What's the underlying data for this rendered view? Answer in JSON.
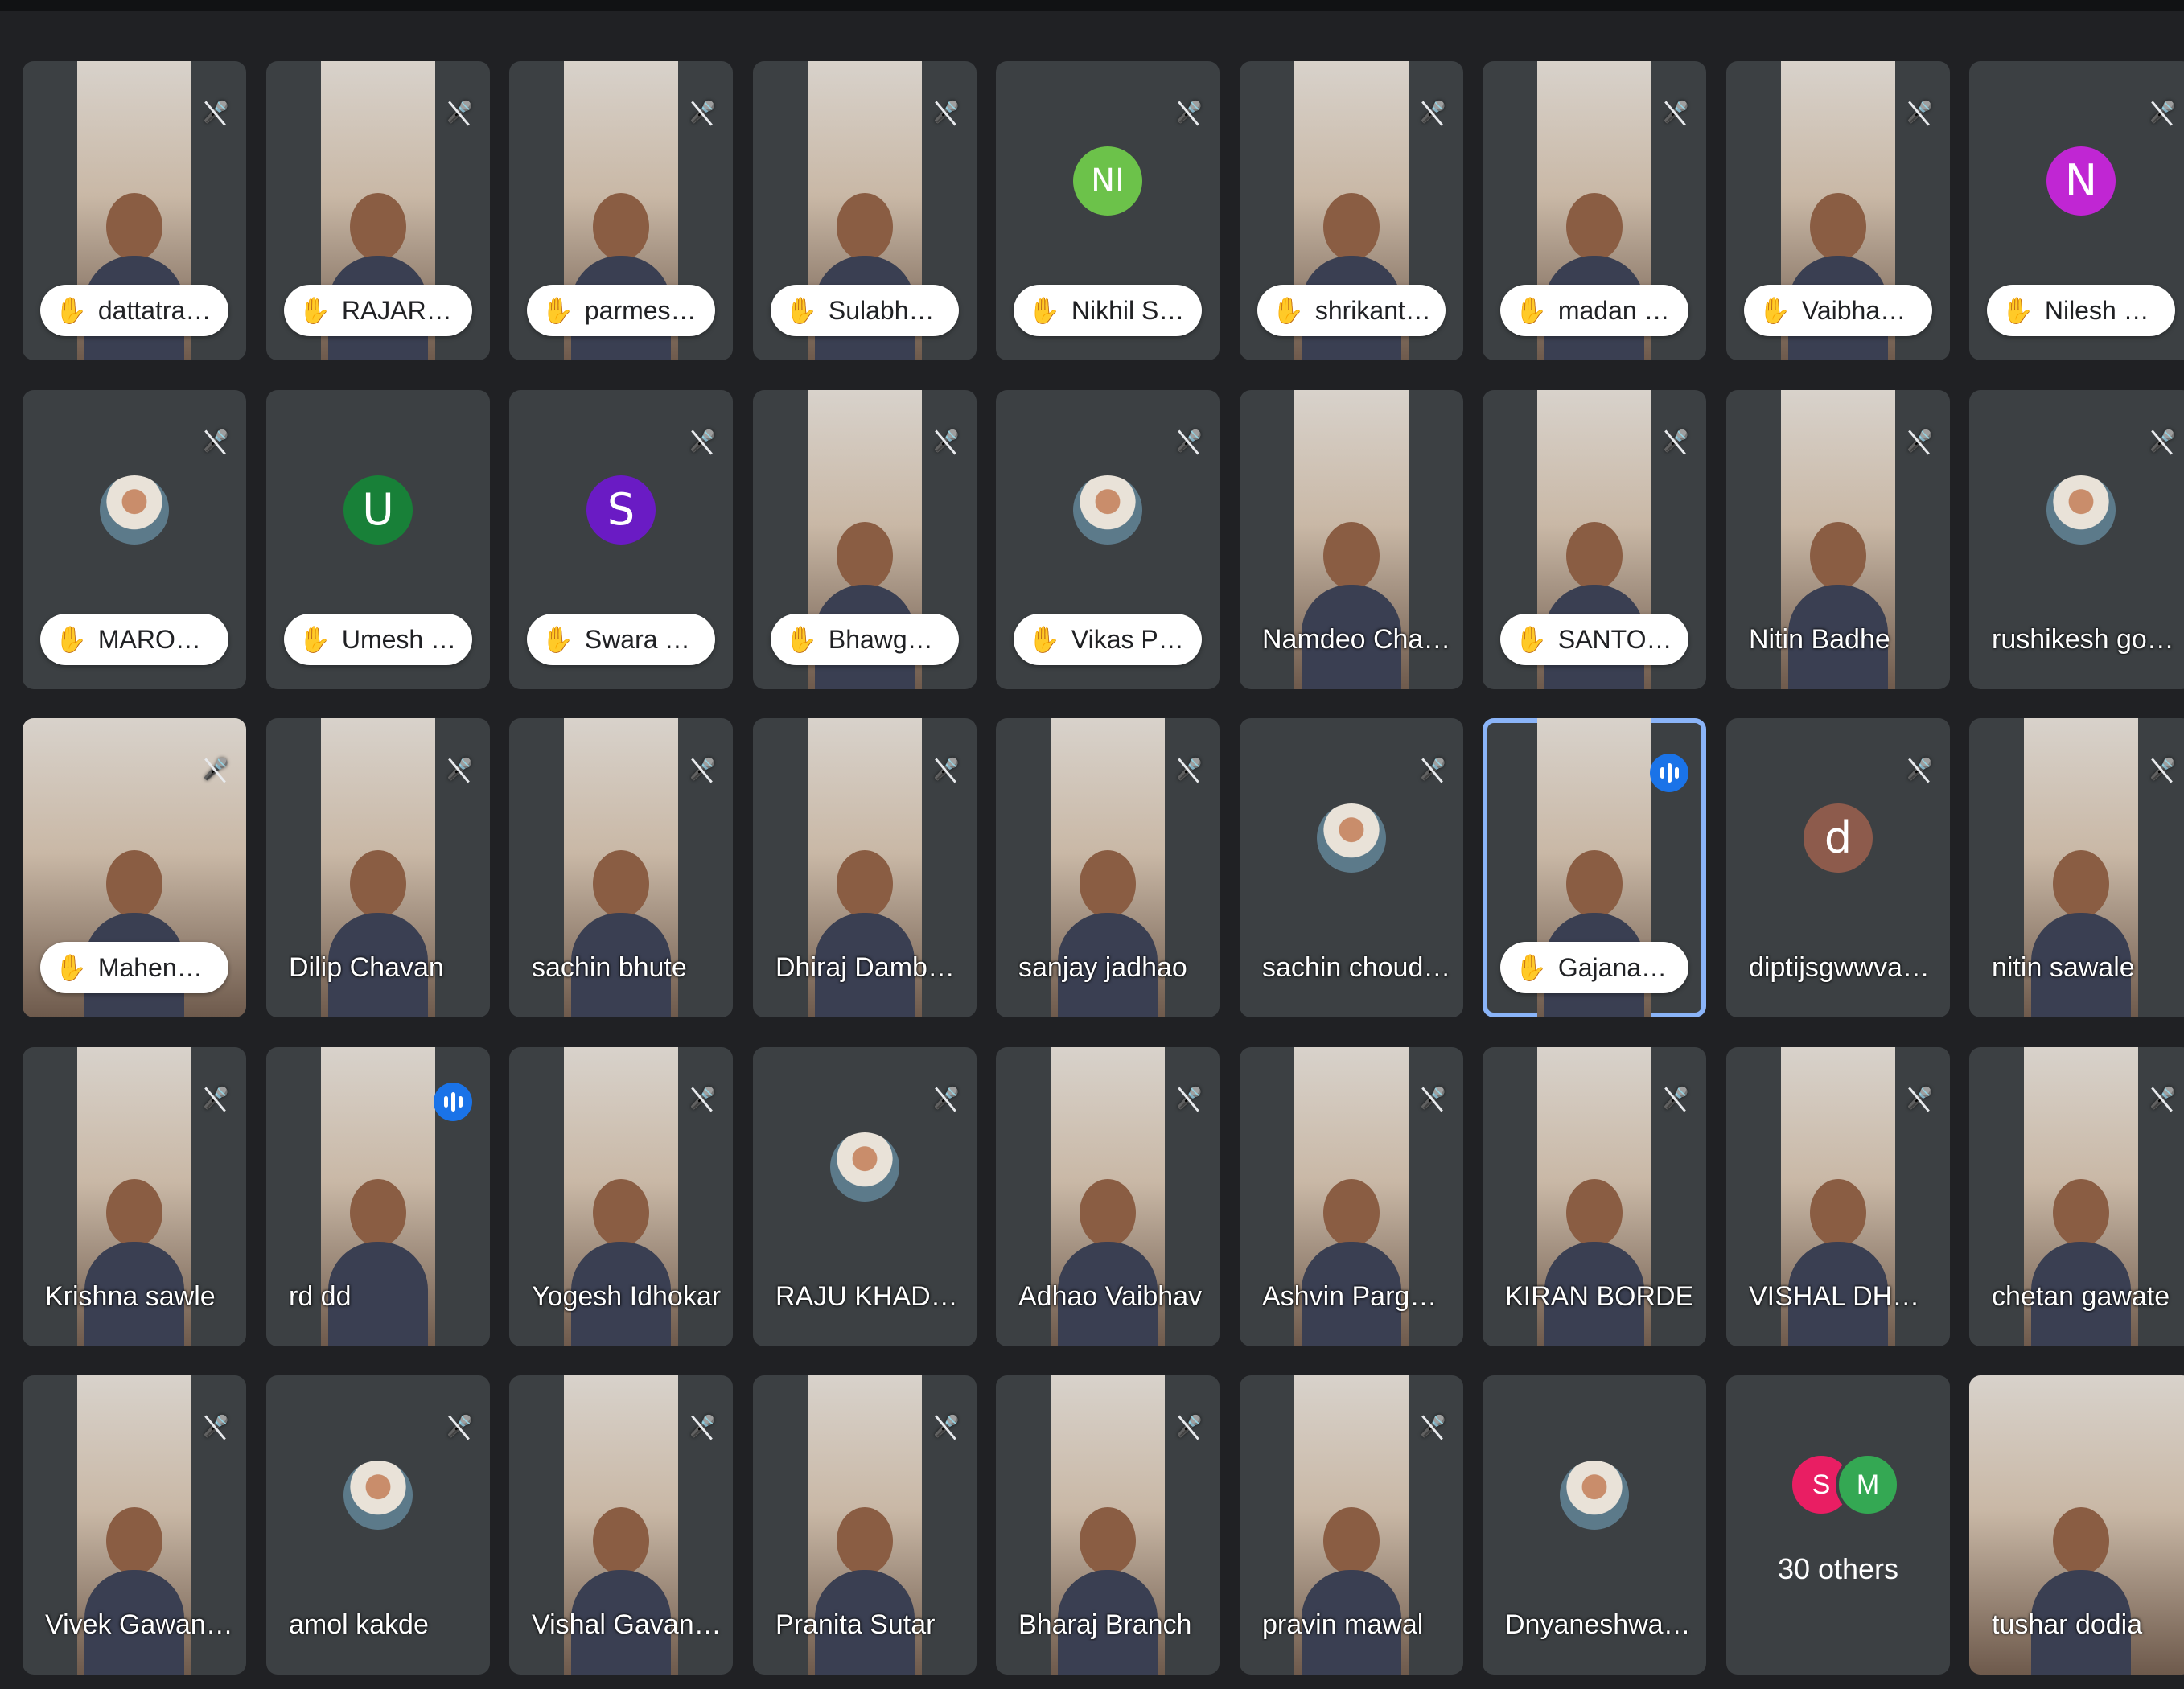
{
  "colors": {
    "background": "#202124",
    "tile": "#3c4043",
    "speaking_border": "#8ab4f8",
    "speaking_badge": "#1a73e8"
  },
  "participants": [
    {
      "name": "dattatray mi...",
      "hand": true,
      "tile": "video"
    },
    {
      "name": "RAJARSHI S...",
      "hand": true,
      "tile": "video"
    },
    {
      "name": "parmeshwa...",
      "hand": true,
      "tile": "video"
    },
    {
      "name": "Sulabha Patil",
      "hand": true,
      "tile": "video"
    },
    {
      "name": "Nikhil Shim...",
      "hand": true,
      "tile": "avatar",
      "avatar_letter": "NI",
      "avatar_color": "#6cc24a"
    },
    {
      "name": "shrikant sat...",
      "hand": true,
      "tile": "video"
    },
    {
      "name": "madan upare",
      "hand": true,
      "tile": "video"
    },
    {
      "name": "Vaibhav Ga...",
      "hand": true,
      "tile": "video"
    },
    {
      "name": "Nilesh Bhan...",
      "hand": true,
      "tile": "avatar",
      "avatar_letter": "N",
      "avatar_color": "#c026d3"
    },
    {
      "name": "MAROTI PA...",
      "hand": true,
      "tile": "photo"
    },
    {
      "name": "Umesh Wagh",
      "hand": true,
      "tile": "avatar",
      "avatar_letter": "U",
      "avatar_color": "#188038",
      "no_mic": true
    },
    {
      "name": "Swara Thete",
      "hand": true,
      "tile": "avatar",
      "avatar_letter": "S",
      "avatar_color": "#6a1bc4"
    },
    {
      "name": "Bhawgwat ...",
      "hand": true,
      "tile": "video"
    },
    {
      "name": "Vikas Patil D...",
      "hand": true,
      "tile": "photo"
    },
    {
      "name": "Namdeo Chavh...",
      "hand": false,
      "tile": "video",
      "no_mic": true
    },
    {
      "name": "SANTOSH D...",
      "hand": true,
      "tile": "video"
    },
    {
      "name": "Nitin Badhe",
      "hand": false,
      "tile": "video"
    },
    {
      "name": "rushikesh gosavi",
      "hand": false,
      "tile": "photo"
    },
    {
      "name": "Mahendra R...",
      "hand": true,
      "tile": "video-wide"
    },
    {
      "name": "Dilip Chavan",
      "hand": false,
      "tile": "video"
    },
    {
      "name": "sachin bhute",
      "hand": false,
      "tile": "video"
    },
    {
      "name": "Dhiraj Dambelk...",
      "hand": false,
      "tile": "video"
    },
    {
      "name": "sanjay jadhao",
      "hand": false,
      "tile": "video"
    },
    {
      "name": "sachin choudh...",
      "hand": false,
      "tile": "photo"
    },
    {
      "name": "Gajanan Kol...",
      "hand": true,
      "tile": "video",
      "speaking": true
    },
    {
      "name": "diptijsgwwvava...",
      "hand": false,
      "tile": "avatar",
      "avatar_letter": "d",
      "avatar_color": "#8d5b4c"
    },
    {
      "name": "nitin sawale",
      "hand": false,
      "tile": "video"
    },
    {
      "name": "Krishna sawle",
      "hand": false,
      "tile": "video"
    },
    {
      "name": "rd dd",
      "hand": false,
      "tile": "video",
      "speaking_badge": true
    },
    {
      "name": "Yogesh Idhokar",
      "hand": false,
      "tile": "video"
    },
    {
      "name": "RAJU KHADKE",
      "hand": false,
      "tile": "photo"
    },
    {
      "name": "Adhao Vaibhav",
      "hand": false,
      "tile": "video"
    },
    {
      "name": "Ashvin Parghar...",
      "hand": false,
      "tile": "video"
    },
    {
      "name": "KIRAN BORDE",
      "hand": false,
      "tile": "video"
    },
    {
      "name": "VISHAL DHON...",
      "hand": false,
      "tile": "video"
    },
    {
      "name": "chetan gawate",
      "hand": false,
      "tile": "video"
    },
    {
      "name": "Vivek Gawande",
      "hand": false,
      "tile": "video"
    },
    {
      "name": "amol kakde",
      "hand": false,
      "tile": "photo"
    },
    {
      "name": "Vishal Gavande",
      "hand": false,
      "tile": "video"
    },
    {
      "name": "Pranita Sutar",
      "hand": false,
      "tile": "video"
    },
    {
      "name": "Bharaj Branch",
      "hand": false,
      "tile": "video"
    },
    {
      "name": "pravin mawal",
      "hand": false,
      "tile": "video"
    },
    {
      "name": "Dnyaneshwar A...",
      "hand": false,
      "tile": "photo",
      "no_mic": true
    },
    {
      "name": "",
      "hand": false,
      "tile": "others",
      "no_mic": true
    },
    {
      "name": "tushar dodia",
      "hand": false,
      "tile": "video-wide",
      "no_mic": true
    }
  ],
  "others": {
    "label": "30 others",
    "avatars": [
      {
        "letter": "S",
        "color": "#e91e63"
      },
      {
        "letter": "M",
        "color": "#34a853"
      }
    ]
  },
  "icons": {
    "hand": "raised-hand-icon",
    "mic_off": "mic-off-icon",
    "speaking": "audio-level-icon"
  }
}
